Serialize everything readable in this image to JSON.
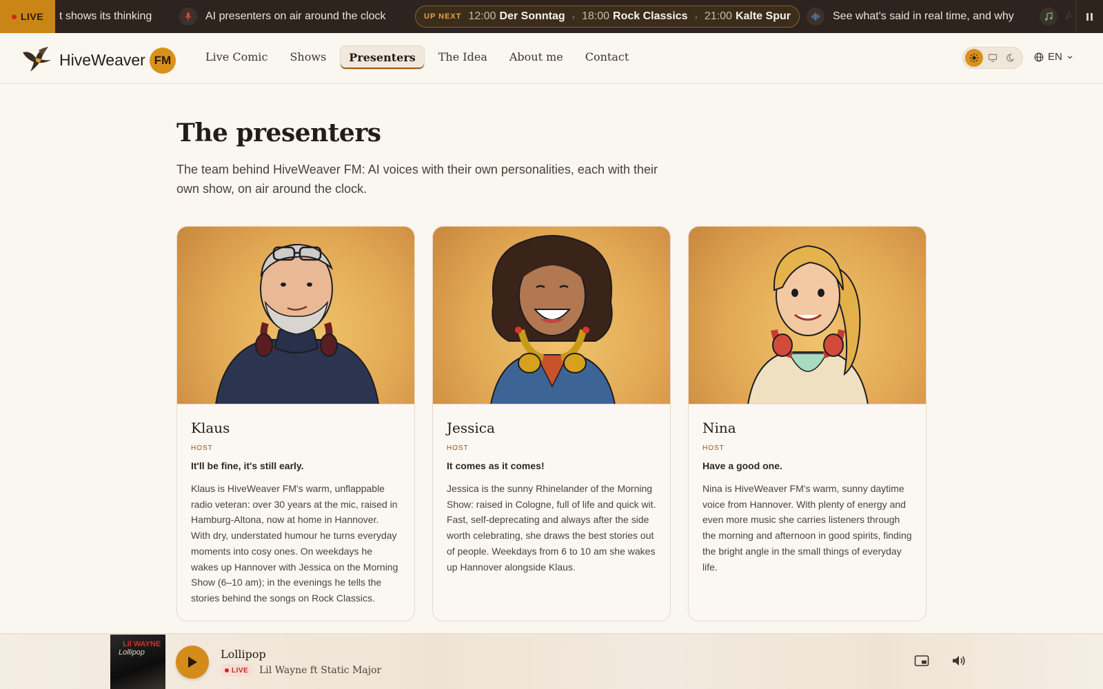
{
  "ticker": {
    "live_label": "LIVE",
    "items": [
      "t shows its thinking",
      "AI presenters on air around the clock",
      "See what's said in real time, and why",
      "A"
    ],
    "up_next": {
      "label": "UP NEXT",
      "shows": [
        {
          "time": "12:00",
          "name": "Der Sonntag"
        },
        {
          "time": "18:00",
          "name": "Rock Classics"
        },
        {
          "time": "21:00",
          "name": "Kalte Spur"
        }
      ]
    },
    "icons": [
      "microphone-icon",
      "waveform-icon",
      "music-note-icon",
      "pause-icon"
    ]
  },
  "header": {
    "brand": "HiveWeaver",
    "brand_badge": "FM",
    "nav": [
      {
        "label": "Live Comic",
        "active": false
      },
      {
        "label": "Shows",
        "active": false
      },
      {
        "label": "Presenters",
        "active": true
      },
      {
        "label": "The Idea",
        "active": false
      },
      {
        "label": "About me",
        "active": false
      },
      {
        "label": "Contact",
        "active": false
      }
    ],
    "theme_modes": [
      "sun-icon",
      "monitor-icon",
      "moon-icon"
    ],
    "theme_selected": "light",
    "language": "EN"
  },
  "main": {
    "title": "The presenters",
    "subtitle": "The team behind HiveWeaver FM: AI voices with their own personalities, each with their own show, on air around the clock."
  },
  "presenters": [
    {
      "name": "Klaus",
      "role": "HOST",
      "tagline": "It'll be fine, it's still early.",
      "bio": "Klaus is HiveWeaver FM's warm, unflappable radio veteran: over 30 years at the mic, raised in Hamburg-Altona, now at home in Hannover. With dry, understated humour he turns everyday moments into cosy ones. On weekdays he wakes up Hannover with Jessica on the Morning Show (6–10 am); in the evenings he tells the stories behind the songs on Rock Classics."
    },
    {
      "name": "Jessica",
      "role": "HOST",
      "tagline": "It comes as it comes!",
      "bio": "Jessica is the sunny Rhinelander of the Morning Show: raised in Cologne, full of life and quick wit. Fast, self-deprecating and always after the side worth celebrating, she draws the best stories out of people. Weekdays from 6 to 10 am she wakes up Hannover alongside Klaus."
    },
    {
      "name": "Nina",
      "role": "HOST",
      "tagline": "Have a good one.",
      "bio": "Nina is HiveWeaver FM's warm, sunny daytime voice from Hannover. With plenty of energy and even more music she carries listeners through the morning and afternoon in good spirits, finding the bright angle in the small things of everyday life."
    }
  ],
  "player": {
    "cover_line1": "Lil WAYNE",
    "cover_line2": "Lollipop",
    "title": "Lollipop",
    "live_label": "LIVE",
    "artist": "Lil Wayne ft Static Major",
    "state": "paused",
    "colors": {
      "accent": "#d38c1b",
      "live": "#d3261c"
    }
  }
}
